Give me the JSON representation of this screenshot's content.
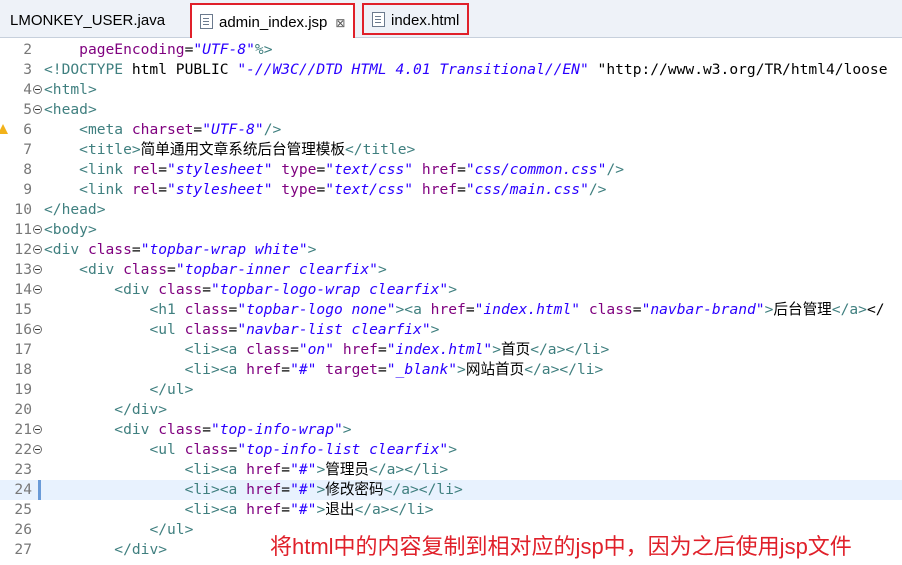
{
  "tabs": [
    {
      "label": "LMONKEY_USER.java"
    },
    {
      "label": "admin_index.jsp",
      "close": "⊠"
    },
    {
      "label": "index.html"
    }
  ],
  "lines": [
    {
      "n": "2",
      "code": "    pageEncoding=\"UTF-8\"%>"
    },
    {
      "n": "3",
      "code": "<!DOCTYPE html PUBLIC \"-//W3C//DTD HTML 4.01 Transitional//EN\" \"http://www.w3.org/TR/html4/loose"
    },
    {
      "n": "4",
      "code": "<html>"
    },
    {
      "n": "5",
      "code": "<head>"
    },
    {
      "n": "6",
      "code": "    <meta charset=\"UTF-8\"/>"
    },
    {
      "n": "7",
      "code": "    <title>简单通用文章系统后台管理模板</title>"
    },
    {
      "n": "8",
      "code": "    <link rel=\"stylesheet\" type=\"text/css\" href=\"css/common.css\"/>"
    },
    {
      "n": "9",
      "code": "    <link rel=\"stylesheet\" type=\"text/css\" href=\"css/main.css\"/>"
    },
    {
      "n": "10",
      "code": "</head>"
    },
    {
      "n": "11",
      "code": "<body>"
    },
    {
      "n": "12",
      "code": "<div class=\"topbar-wrap white\">"
    },
    {
      "n": "13",
      "code": "    <div class=\"topbar-inner clearfix\">"
    },
    {
      "n": "14",
      "code": "        <div class=\"topbar-logo-wrap clearfix\">"
    },
    {
      "n": "15",
      "code": "            <h1 class=\"topbar-logo none\"><a href=\"index.html\" class=\"navbar-brand\">后台管理</a></"
    },
    {
      "n": "16",
      "code": "            <ul class=\"navbar-list clearfix\">"
    },
    {
      "n": "17",
      "code": "                <li><a class=\"on\" href=\"index.html\">首页</a></li>"
    },
    {
      "n": "18",
      "code": "                <li><a href=\"#\" target=\"_blank\">网站首页</a></li>"
    },
    {
      "n": "19",
      "code": "            </ul>"
    },
    {
      "n": "20",
      "code": "        </div>"
    },
    {
      "n": "21",
      "code": "        <div class=\"top-info-wrap\">"
    },
    {
      "n": "22",
      "code": "            <ul class=\"top-info-list clearfix\">"
    },
    {
      "n": "23",
      "code": "                <li><a href=\"#\">管理员</a></li>"
    },
    {
      "n": "24",
      "code": "                <li><a href=\"#\">修改密码</a></li>"
    },
    {
      "n": "25",
      "code": "                <li><a href=\"#\">退出</a></li>"
    },
    {
      "n": "26",
      "code": "            </ul>"
    },
    {
      "n": "27",
      "code": "        </div>"
    }
  ],
  "annotation": "将html中的内容复制到相对应的jsp中，因为之后使用jsp文件",
  "colors": {
    "highlight_border": "#e0202a",
    "tag": "#3f7f7f",
    "attr": "#7f007f",
    "value": "#2a00ff"
  }
}
